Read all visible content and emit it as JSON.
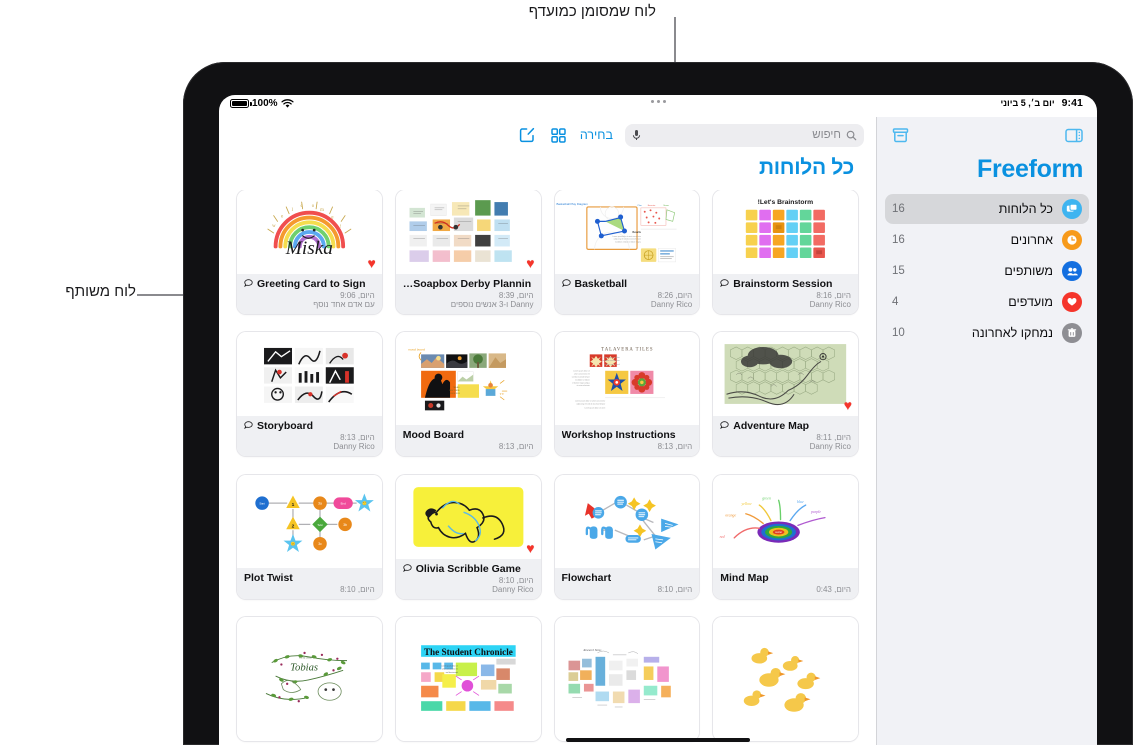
{
  "annotations": [
    {
      "id": "favorite",
      "text": "לוח שמסומן כמועדף"
    },
    {
      "id": "shared",
      "text": "לוח משותף"
    }
  ],
  "status_bar": {
    "battery_percent": "100%",
    "wifi_icon": "wifi-icon",
    "battery_icon": "battery-full-icon",
    "time": "9:41",
    "date": "יום ב׳, 5 ביוני",
    "multitask_icon": "multitasking-dots-icon"
  },
  "sidebar": {
    "app_title": "Freeform",
    "archive_icon": "archive-box-icon",
    "sidebar_toggle_icon": "sidebar-toggle-icon",
    "items": [
      {
        "label": "כל הלוחות",
        "count": "16",
        "icon": "boards-icon",
        "color": "#3eb4f0",
        "selected": true
      },
      {
        "label": "אחרונים",
        "count": "16",
        "icon": "clock-icon",
        "color": "#f79a1a",
        "selected": false
      },
      {
        "label": "משותפים",
        "count": "15",
        "icon": "people-icon",
        "color": "#136fe0",
        "selected": false
      },
      {
        "label": "מועדפים",
        "count": "4",
        "icon": "heart-icon",
        "color": "#f5352b",
        "selected": false
      },
      {
        "label": "נמחקו לאחרונה",
        "count": "10",
        "icon": "trash-icon",
        "color": "#8e8e93",
        "selected": false
      }
    ]
  },
  "main": {
    "title": "כל הלוחות",
    "toolbar": {
      "compose_icon": "compose-square-pencil-icon",
      "grid_icon": "grid-view-icon",
      "select_label": "בחירה",
      "search_placeholder": "חיפוש",
      "search_value": "",
      "search_icon": "search-icon",
      "mic_icon": "microphone-icon"
    },
    "boards": [
      {
        "name": "Brainstorm Session",
        "time": "היום, 8:16",
        "owner": "Danny Rico",
        "shared": true,
        "favorite": false,
        "thumb": "brainstorm-stickies"
      },
      {
        "name": "Basketball",
        "time": "היום, 8:26",
        "owner": "Danny Rico",
        "shared": true,
        "favorite": false,
        "thumb": "basketball-play-diagram"
      },
      {
        "name": "Soapbox Derby Plannin…",
        "time": "היום, 8:39",
        "owner": "Danny ו-3 אנשים נוספים",
        "shared": false,
        "favorite": true,
        "thumb": "soapbox-derby-collage"
      },
      {
        "name": "Greeting Card to Sign",
        "time": "היום, 9:06",
        "owner": "עם אדם אחד נוסף",
        "shared": true,
        "favorite": true,
        "thumb": "rainbow-greeting-card"
      },
      {
        "name": "Adventure Map",
        "time": "היום, 8:11",
        "owner": "Danny Rico",
        "shared": true,
        "favorite": true,
        "thumb": "hex-adventure-map"
      },
      {
        "name": "Workshop Instructions",
        "time": "היום, 8:13",
        "owner": "",
        "shared": false,
        "favorite": false,
        "thumb": "talavera-tiles"
      },
      {
        "name": "Mood Board",
        "time": "היום, 8:13",
        "owner": "",
        "shared": false,
        "favorite": false,
        "thumb": "mood-board-photos"
      },
      {
        "name": "Storyboard",
        "time": "היום, 8:13",
        "owner": "Danny Rico",
        "shared": true,
        "favorite": false,
        "thumb": "storyboard-frames"
      },
      {
        "name": "Mind Map",
        "time": "היום, 0:43",
        "owner": "",
        "shared": false,
        "favorite": false,
        "thumb": "mind-map-sketch"
      },
      {
        "name": "Flowchart",
        "time": "היום, 8:10",
        "owner": "",
        "shared": false,
        "favorite": false,
        "thumb": "flowchart-nodes"
      },
      {
        "name": "Olivia Scribble Game",
        "time": "היום, 8:10",
        "owner": "Danny Rico",
        "shared": true,
        "favorite": true,
        "thumb": "yellow-scribble-dog"
      },
      {
        "name": "Plot Twist",
        "time": "היום, 8:10",
        "owner": "",
        "shared": false,
        "favorite": false,
        "thumb": "plot-twist-nodes"
      },
      {
        "name": "",
        "time": "",
        "owner": "",
        "shared": false,
        "favorite": false,
        "thumb": "rubber-ducks"
      },
      {
        "name": "",
        "time": "",
        "owner": "",
        "shared": false,
        "favorite": false,
        "thumb": "research-collage"
      },
      {
        "name": "",
        "time": "",
        "owner": "",
        "shared": false,
        "favorite": false,
        "thumb": "student-chronicle"
      },
      {
        "name": "",
        "time": "",
        "owner": "",
        "shared": false,
        "favorite": false,
        "thumb": "ivy-vines"
      }
    ]
  },
  "colors": {
    "accent_blue": "#0a91e0",
    "favorite_red": "#f5352b",
    "sidebar_bg": "#f1f2f6",
    "card_meta_bg": "#eff0f3"
  }
}
